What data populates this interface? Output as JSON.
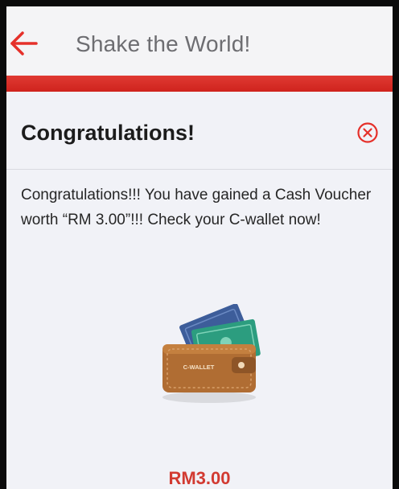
{
  "app_bar": {
    "title": "Shake the World!",
    "back_icon": "arrow-left-icon"
  },
  "colors": {
    "accent_red": "#e5302a",
    "amount_red": "#d23a31",
    "title_gray": "#6d6d71"
  },
  "dialog": {
    "title": "Congratulations!",
    "close_icon": "close-circle-icon",
    "message": "Congratulations!!! You have gained a Cash Voucher worth “RM 3.00”!!! Check your C-wallet now!",
    "wallet_icon": "c-wallet-icon",
    "wallet_label": "C-WALLET",
    "amount": "RM3.00"
  }
}
